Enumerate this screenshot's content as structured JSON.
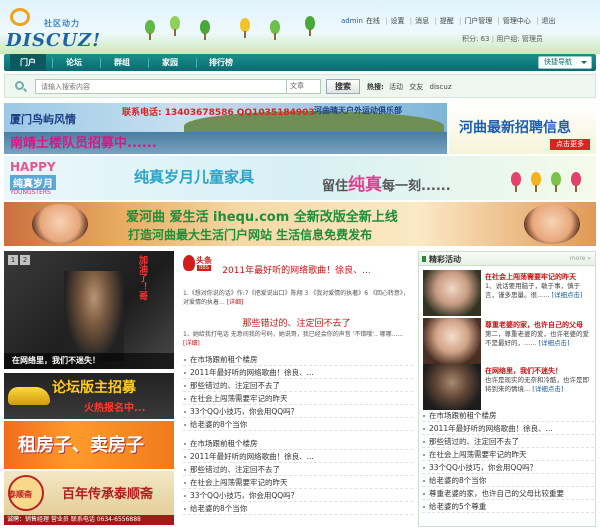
{
  "header": {
    "logo_cn": "社区动力",
    "logo_en": "DISCUZ!",
    "user": "admin",
    "status": "在线",
    "links": [
      "设置",
      "消息",
      "提醒",
      "门户管理",
      "管理中心",
      "退出"
    ],
    "credits_label": "积分: 63",
    "group_label": "用户组: 管理员"
  },
  "nav": {
    "items": [
      "门户",
      "论坛",
      "群组",
      "家园",
      "排行榜"
    ],
    "active_index": 0,
    "quick_nav": "快捷导航"
  },
  "search": {
    "placeholder": "请输入搜索内容",
    "type": "文章",
    "button": "搜索",
    "hot_label": "热搜:",
    "hot_terms": [
      "活动",
      "交友",
      "discuz"
    ]
  },
  "banners": {
    "b1_title": "厦门鸟屿风情",
    "b1_phone": "联系电话: 13403678586 QQ1035184903",
    "b1_club": "河曲晴天户外运动俱乐部",
    "b1_recruit": "南靖土楼队员招募中......",
    "b2_title": "河曲最新招聘信息",
    "b2_button": "点击更多",
    "b3_happy": "HAPPY",
    "b3_sub": "纯真岁月",
    "b3_youngsters": "YOUNGSTERS",
    "b3_mid": "纯真岁月儿童家具",
    "b3_right_a": "留住",
    "b3_right_b": "纯真",
    "b3_right_c": "每一刻......",
    "b4_line1": "爱河曲 爱生活 ihequ.com 全新改版全新上线",
    "b4_line2": "打造河曲最大生活门户网站 生活信息免费发布"
  },
  "slideshow": {
    "numbers": [
      "1",
      "2"
    ],
    "caption": "在网络里，我们不迷失！",
    "side_text": "加油了！哥"
  },
  "left_ads": {
    "ad1_title": "论坛版主招募",
    "ad1_sub": "火热报名中...",
    "ad2_title": "租房子、卖房子",
    "ad3_seal": "泰顺斋",
    "ad3_title": "百年传承泰顺斋",
    "ad3_footer": "诚聘：销售经理 营业员 联系电话 0634-6556888"
  },
  "news": {
    "logo_title": "头条",
    "logo_badge": "BBS",
    "headline1": "2011年最好听的网络歌曲！徐良、...",
    "summary1": "1.《想对你说的话》作:7《把爱说出口》陈翔 3 《我对爱情的执著》6 《回心转意》，对爱情的执着...",
    "detail_label": "[详细]",
    "headline2": "那些错过的、注定回不去了",
    "summary2": "1、她给我打电话 无意间我的号码，她说哥，我已经会你的声音 '不错哦'.. 哪哪......",
    "list1": [
      "在市场跟前租个楼房",
      "2011年最好听的网络歌曲！徐良、...",
      "那些错过的、注定回不去了",
      "在社会上闯荡需要牢记的昨天",
      "33个QQ小技巧，你会用QQ吗？",
      "给老婆的8个当你"
    ],
    "list2": [
      "在市场跟前租个楼房",
      "2011年最好听的网络歌曲！徐良、...",
      "那些错过的、注定回不去了",
      "在社会上闯荡需要牢记的昨天",
      "33个QQ小技巧，你会用QQ吗？",
      "给老婆的8个当你"
    ]
  },
  "activities": {
    "title": "精彩活动",
    "more": "more »",
    "items": [
      {
        "title": "在社会上闯荡需要牢记的昨天",
        "desc": "1、说话要用脑子，敏于事，慎于言，谨多思量。很......",
        "link": "[详细点击]"
      },
      {
        "title": "尊重老婆的家，也许自己的父母",
        "desc": "第二，尊重老婆的爱，也许老婆的爱不是最好的，......",
        "link": "[详细点击]"
      },
      {
        "title": "在网络里，我们不迷失！",
        "desc": "也许是现实的无奈和冷酷，也许是即将到来的情境...",
        "link": "[详细点击]"
      }
    ],
    "list": [
      "在市场跟前租个楼房",
      "2011年最好听的网络歌曲！徐良、...",
      "那些错过的、注定回不去了",
      "在社会上闯荡需要牢记的昨天",
      "33个QQ小技巧，你会用QQ吗？",
      "给老婆的8个当你",
      "尊重老婆的家，也许自己的父母比较重要",
      "给老婆的5个尊重"
    ]
  }
}
